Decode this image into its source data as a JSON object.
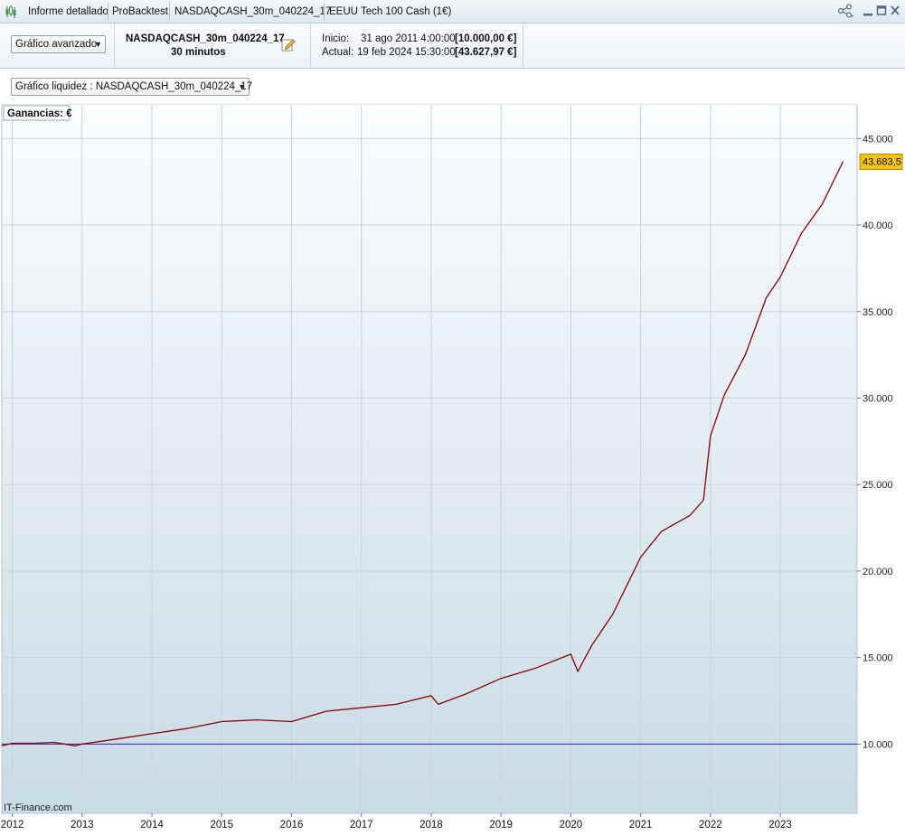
{
  "colors": {
    "loss": "#8b0000",
    "gain": "#0a6a0a",
    "baseline": "#2222bb",
    "last_badge": "#f3c316"
  },
  "titlebar": {
    "app_icon": "candlestick-icon",
    "tabs": [
      {
        "label": "Informe detallado"
      },
      {
        "label": "ProBacktest"
      },
      {
        "label": "NASDAQCASH_30m_040224_17"
      },
      {
        "label": "EEUU Tech 100 Cash (1€)"
      }
    ],
    "icons": [
      "share-icon",
      "minimize-icon",
      "maximize-icon",
      "close-icon"
    ]
  },
  "toolbar": {
    "view_select": {
      "value": "Gráfico avanzado"
    },
    "system": {
      "name": "NASDAQCASH_30m_040224_17",
      "timeframe": "30 minutos",
      "edit_icon": "pencil-icon"
    },
    "inicio": {
      "label": "Inicio:",
      "date": "31 ago 2011 4:00:00",
      "value": "[10.000,00 €]"
    },
    "actual": {
      "label": "Actual:",
      "date": "19 feb 2024 15:30:00",
      "value": "[43.627,97 €]"
    }
  },
  "chart_selector": {
    "value": "Gráfico liquidez : NASDAQCASH_30m_040224_17"
  },
  "chart_data": {
    "type": "line",
    "legend_label": "Ganancias: €",
    "watermark": "IT-Finance.com",
    "last_value_label": "43.683,5",
    "baseline": 10000,
    "ylim": [
      6000,
      47000
    ],
    "xlim": [
      2011.85,
      2024.1
    ],
    "y_ticks": [
      {
        "v": 10000,
        "label": "10.000"
      },
      {
        "v": 15000,
        "label": "15.000"
      },
      {
        "v": 20000,
        "label": "20.000"
      },
      {
        "v": 25000,
        "label": "25.000"
      },
      {
        "v": 30000,
        "label": "30.000"
      },
      {
        "v": 35000,
        "label": "35.000"
      },
      {
        "v": 40000,
        "label": "40.000"
      },
      {
        "v": 45000,
        "label": "45.000"
      }
    ],
    "x_ticks": [
      {
        "v": 2012,
        "label": "2012"
      },
      {
        "v": 2013,
        "label": "2013"
      },
      {
        "v": 2014,
        "label": "2014"
      },
      {
        "v": 2015,
        "label": "2015"
      },
      {
        "v": 2016,
        "label": "2016"
      },
      {
        "v": 2017,
        "label": "2017"
      },
      {
        "v": 2018,
        "label": "2018"
      },
      {
        "v": 2019,
        "label": "2019"
      },
      {
        "v": 2020,
        "label": "2020"
      },
      {
        "v": 2021,
        "label": "2021"
      },
      {
        "v": 2022,
        "label": "2022"
      },
      {
        "v": 2023,
        "label": "2023"
      }
    ],
    "series": [
      {
        "points": [
          [
            2011.85,
            9900
          ],
          [
            2012.0,
            10050
          ],
          [
            2012.3,
            10050
          ],
          [
            2012.6,
            10100
          ],
          [
            2012.9,
            9900
          ],
          [
            2013.0,
            10000
          ],
          [
            2013.5,
            10300
          ],
          [
            2014.0,
            10600
          ],
          [
            2014.5,
            10900
          ],
          [
            2015.0,
            11300
          ],
          [
            2015.5,
            11400
          ],
          [
            2016.0,
            11300
          ],
          [
            2016.5,
            11900
          ],
          [
            2017.0,
            12100
          ],
          [
            2017.5,
            12300
          ],
          [
            2018.0,
            12800
          ],
          [
            2018.1,
            12300
          ],
          [
            2018.5,
            12900
          ],
          [
            2019.0,
            13800
          ],
          [
            2019.5,
            14400
          ],
          [
            2020.0,
            15200
          ],
          [
            2020.1,
            14200
          ],
          [
            2020.3,
            15700
          ],
          [
            2020.6,
            17500
          ],
          [
            2021.0,
            20800
          ],
          [
            2021.3,
            22300
          ],
          [
            2021.7,
            23200
          ],
          [
            2021.9,
            24100
          ],
          [
            2022.0,
            27800
          ],
          [
            2022.2,
            30200
          ],
          [
            2022.5,
            32500
          ],
          [
            2022.8,
            35800
          ],
          [
            2023.0,
            37000
          ],
          [
            2023.3,
            39500
          ],
          [
            2023.6,
            41200
          ],
          [
            2023.9,
            43683
          ]
        ]
      }
    ]
  }
}
